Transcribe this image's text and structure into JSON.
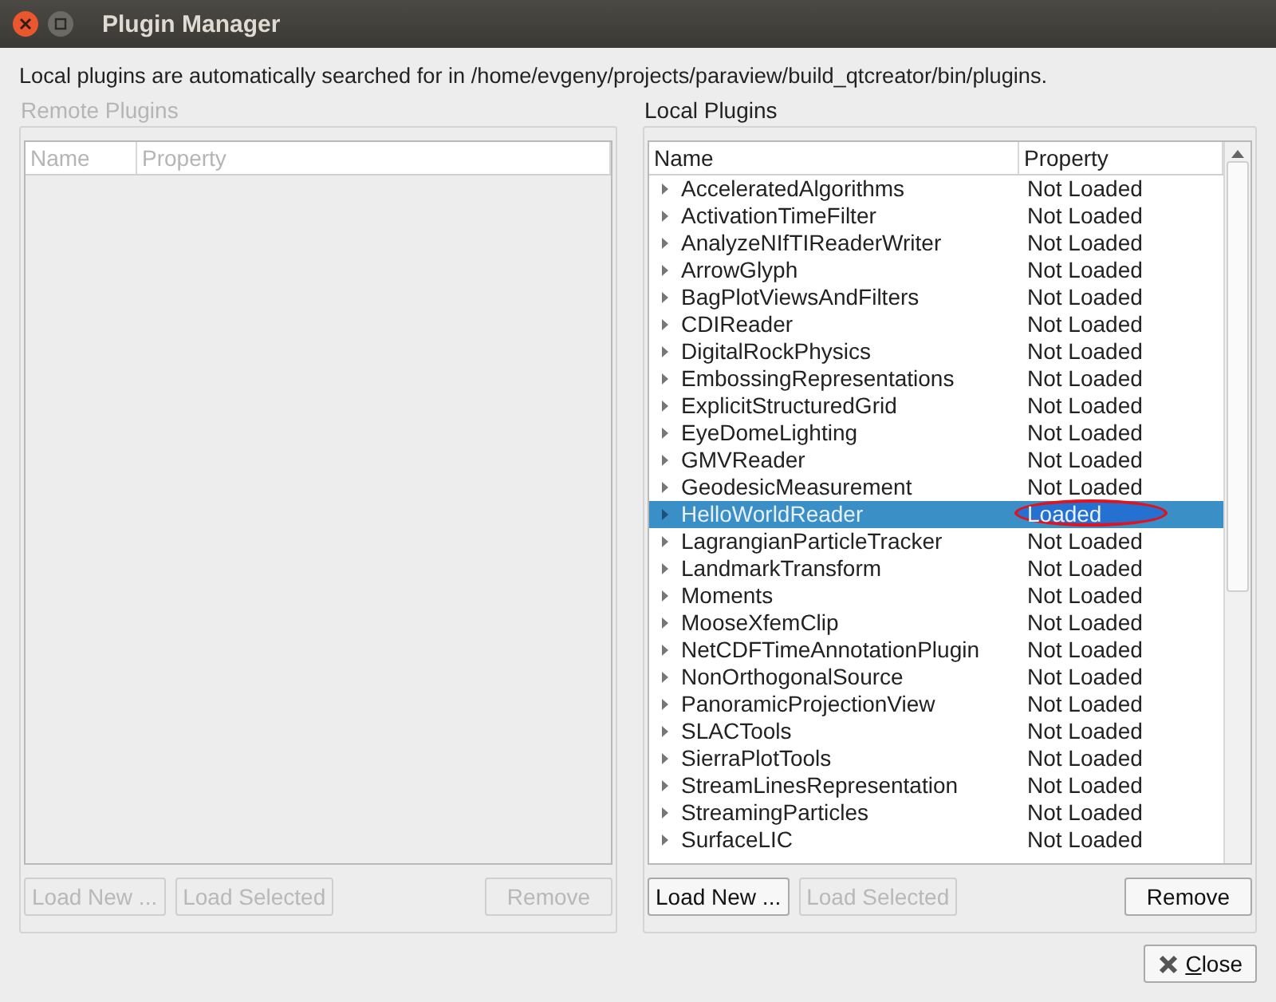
{
  "window": {
    "title": "Plugin Manager"
  },
  "info": "Local plugins are automatically searched for in /home/evgeny/projects/paraview/build_qtcreator/bin/plugins.",
  "remote": {
    "title": "Remote Plugins",
    "disabled": true,
    "columns": [
      "Name",
      "Property"
    ],
    "buttons": [
      {
        "label": "Load New ...",
        "disabled": true
      },
      {
        "label": "Load Selected",
        "disabled": true
      },
      {
        "label": "Remove",
        "disabled": true
      }
    ]
  },
  "local": {
    "title": "Local Plugins",
    "disabled": false,
    "columns": [
      "Name",
      "Property"
    ],
    "rows": [
      {
        "name": "AcceleratedAlgorithms",
        "property": "Not Loaded",
        "selected": false,
        "circled": false
      },
      {
        "name": "ActivationTimeFilter",
        "property": "Not Loaded",
        "selected": false,
        "circled": false
      },
      {
        "name": "AnalyzeNIfTIReaderWriter",
        "property": "Not Loaded",
        "selected": false,
        "circled": false
      },
      {
        "name": "ArrowGlyph",
        "property": "Not Loaded",
        "selected": false,
        "circled": false
      },
      {
        "name": "BagPlotViewsAndFilters",
        "property": "Not Loaded",
        "selected": false,
        "circled": false
      },
      {
        "name": "CDIReader",
        "property": "Not Loaded",
        "selected": false,
        "circled": false
      },
      {
        "name": "DigitalRockPhysics",
        "property": "Not Loaded",
        "selected": false,
        "circled": false
      },
      {
        "name": "EmbossingRepresentations",
        "property": "Not Loaded",
        "selected": false,
        "circled": false
      },
      {
        "name": "ExplicitStructuredGrid",
        "property": "Not Loaded",
        "selected": false,
        "circled": false
      },
      {
        "name": "EyeDomeLighting",
        "property": "Not Loaded",
        "selected": false,
        "circled": false
      },
      {
        "name": "GMVReader",
        "property": "Not Loaded",
        "selected": false,
        "circled": false
      },
      {
        "name": "GeodesicMeasurement",
        "property": "Not Loaded",
        "selected": false,
        "circled": false
      },
      {
        "name": "HelloWorldReader",
        "property": "Loaded",
        "selected": true,
        "circled": true
      },
      {
        "name": "LagrangianParticleTracker",
        "property": "Not Loaded",
        "selected": false,
        "circled": false
      },
      {
        "name": "LandmarkTransform",
        "property": "Not Loaded",
        "selected": false,
        "circled": false
      },
      {
        "name": "Moments",
        "property": "Not Loaded",
        "selected": false,
        "circled": false
      },
      {
        "name": "MooseXfemClip",
        "property": "Not Loaded",
        "selected": false,
        "circled": false
      },
      {
        "name": "NetCDFTimeAnnotationPlugin",
        "property": "Not Loaded",
        "selected": false,
        "circled": false
      },
      {
        "name": "NonOrthogonalSource",
        "property": "Not Loaded",
        "selected": false,
        "circled": false
      },
      {
        "name": "PanoramicProjectionView",
        "property": "Not Loaded",
        "selected": false,
        "circled": false
      },
      {
        "name": "SLACTools",
        "property": "Not Loaded",
        "selected": false,
        "circled": false
      },
      {
        "name": "SierraPlotTools",
        "property": "Not Loaded",
        "selected": false,
        "circled": false
      },
      {
        "name": "StreamLinesRepresentation",
        "property": "Not Loaded",
        "selected": false,
        "circled": false
      },
      {
        "name": "StreamingParticles",
        "property": "Not Loaded",
        "selected": false,
        "circled": false
      },
      {
        "name": "SurfaceLIC",
        "property": "Not Loaded",
        "selected": false,
        "circled": false
      }
    ],
    "buttons": [
      {
        "label": "Load New ...",
        "disabled": false
      },
      {
        "label": "Load Selected",
        "disabled": true
      },
      {
        "label": "Remove",
        "disabled": false
      }
    ]
  },
  "close": {
    "label": "Close"
  }
}
